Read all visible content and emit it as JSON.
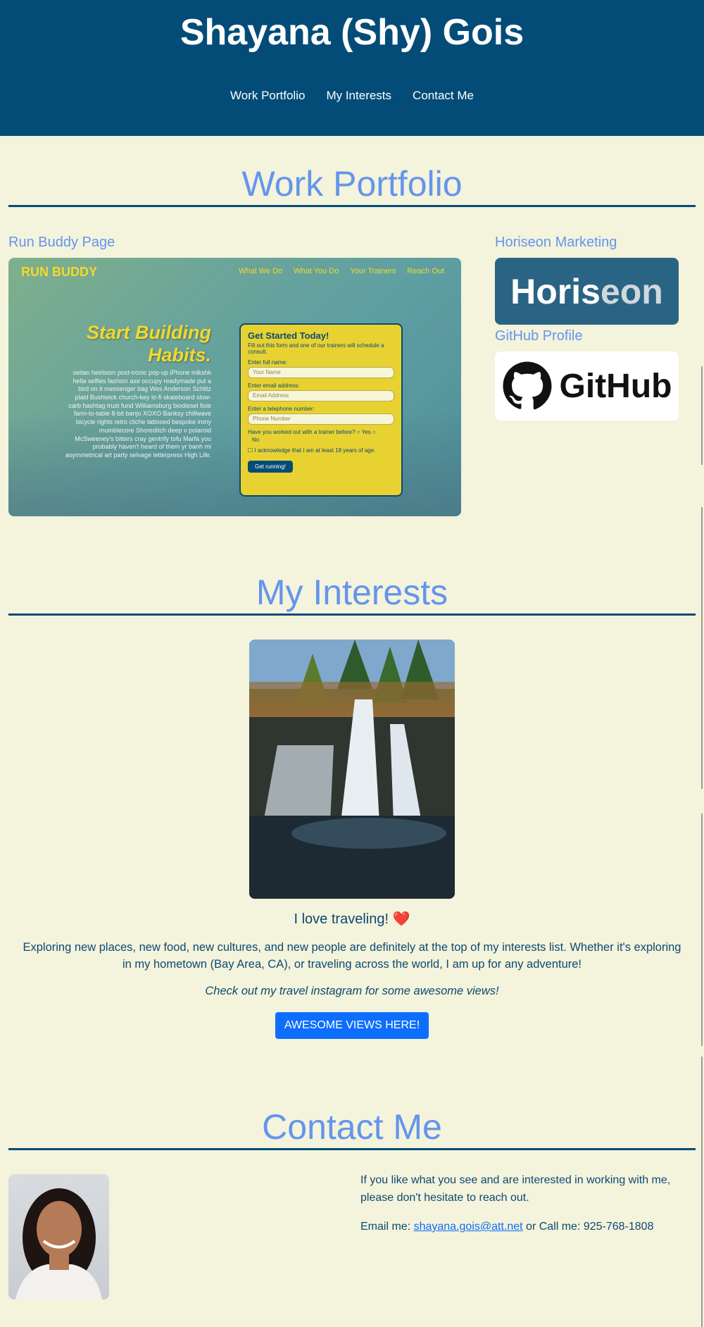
{
  "header": {
    "title": "Shayana (Shy) Gois",
    "nav": [
      "Work Portfolio",
      "My Interests",
      "Contact Me"
    ]
  },
  "portfolio": {
    "title": "Work Portfolio",
    "run_buddy": {
      "label": "Run Buddy Page",
      "logo": "RUN BUDDY",
      "nav": [
        "What We Do",
        "What You Do",
        "Your Trainers",
        "Reach Out"
      ],
      "hero_line1": "Start Building",
      "hero_line2": "Habits.",
      "body": "seitan heirloom post-ironic pop-up iPhone mlkshk hella selfies fashion axe occupy readymade put a bird on it messenger bag Wes Anderson Schlitz plaid Bushwick church-key lo-fi skateboard slow-carb hashtag trust fund Williamsburg biodiesel fixie farm-to-table 8-bit banjo XOXO Banksy chillwave bicycle rights retro cliche tattooed bespoke irony mumblecore Shoreditch deep v polaroid McSweeney's bitters cray gentrify tofu Marfa you probably haven't heard of them yr banh mi asymmetrical art party selvage letterpress High Life.",
      "form": {
        "title": "Get Started Today!",
        "subtitle": "Fill out this form and one of our trainers will schedule a consult.",
        "name_label": "Enter full name:",
        "name_placeholder": "Your Name",
        "email_label": "Enter email address:",
        "email_placeholder": "Email Address",
        "phone_label": "Enter a telephone number:",
        "phone_placeholder": "Phone Number",
        "trainer_question": "Have you worked out with a trainer before?",
        "yes": "Yes",
        "no": "No",
        "ack": "I acknowledge that I am at least 18 years of age.",
        "button": "Get running!"
      }
    },
    "horiseon": {
      "label": "Horiseon Marketing",
      "logo_part1": "Horis",
      "logo_part2": "eon"
    },
    "github": {
      "label": "GitHub Profile",
      "logo": "GitHub"
    }
  },
  "interests": {
    "title": "My Interests",
    "caption": "I love traveling! ",
    "heart": "❤️",
    "text": "Exploring new places, new food, new cultures, and new people are definitely at the top of my interests list. Whether it's exploring in my hometown (Bay Area, CA), or traveling across the world, I am up for any adventure!",
    "italic": "Check out my travel instagram for some awesome views!",
    "button": "AWESOME VIEWS HERE!"
  },
  "contact": {
    "title": "Contact Me",
    "intro": "If you like what you see and are interested in working with me, please don't hesitate to reach out.",
    "email_prefix": "Email me: ",
    "email": "shayana.gois@att.net",
    "phone_text": " or Call me: 925-768-1808"
  },
  "colors": {
    "header_bg": "#044c78",
    "page_bg": "#f4f3dc",
    "heading": "#6495ed",
    "button": "#0d6efd"
  }
}
